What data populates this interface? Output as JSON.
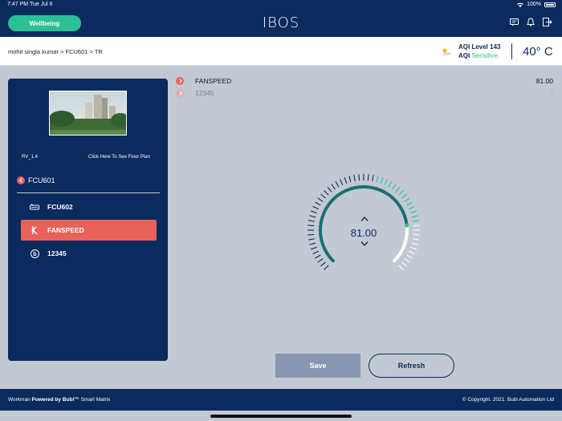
{
  "status_bar": {
    "time": "7:47 PM",
    "date": "Tue Jul 6",
    "battery": "100%"
  },
  "header": {
    "wellbeing_label": "Wellbeing",
    "logo": "IBOS"
  },
  "subheader": {
    "breadcrumb": "mohit singla kumar > FCU601 > TR",
    "aqi_label": "AQI Level 143",
    "aqi_prefix": "AQI",
    "aqi_status": "Sensitive",
    "temperature": "40° C"
  },
  "panel": {
    "room_code": "RV_1.4",
    "floor_plan_link": "Click Here To See Floor Plan",
    "parent": "FCU601",
    "items": [
      {
        "label": "FCU602",
        "icon": "fan-coil-icon",
        "active": false
      },
      {
        "label": "FANSPEED",
        "icon": "fan-speed-icon",
        "active": true
      },
      {
        "label": "12345",
        "icon": "b-circle-icon",
        "active": false
      }
    ]
  },
  "readings": [
    {
      "label": "FANSPEED",
      "value": "81.00"
    },
    {
      "label": "12345",
      "value": "-"
    }
  ],
  "gauge": {
    "value": "81.00",
    "level": 0.81,
    "colors": {
      "filled": "#1b6f72",
      "track": "#ffffff",
      "accent": "#2bbf95",
      "ticks_dark": "#0b2a5e"
    }
  },
  "actions": {
    "save": "Save",
    "refresh": "Refresh"
  },
  "footer": {
    "left_prefix": "Workman",
    "left_bold": "Powered by Bubl™",
    "left_suffix": "Smart Matrix",
    "right": "© Copyright. 2021. Bubl Automation Ltd"
  }
}
